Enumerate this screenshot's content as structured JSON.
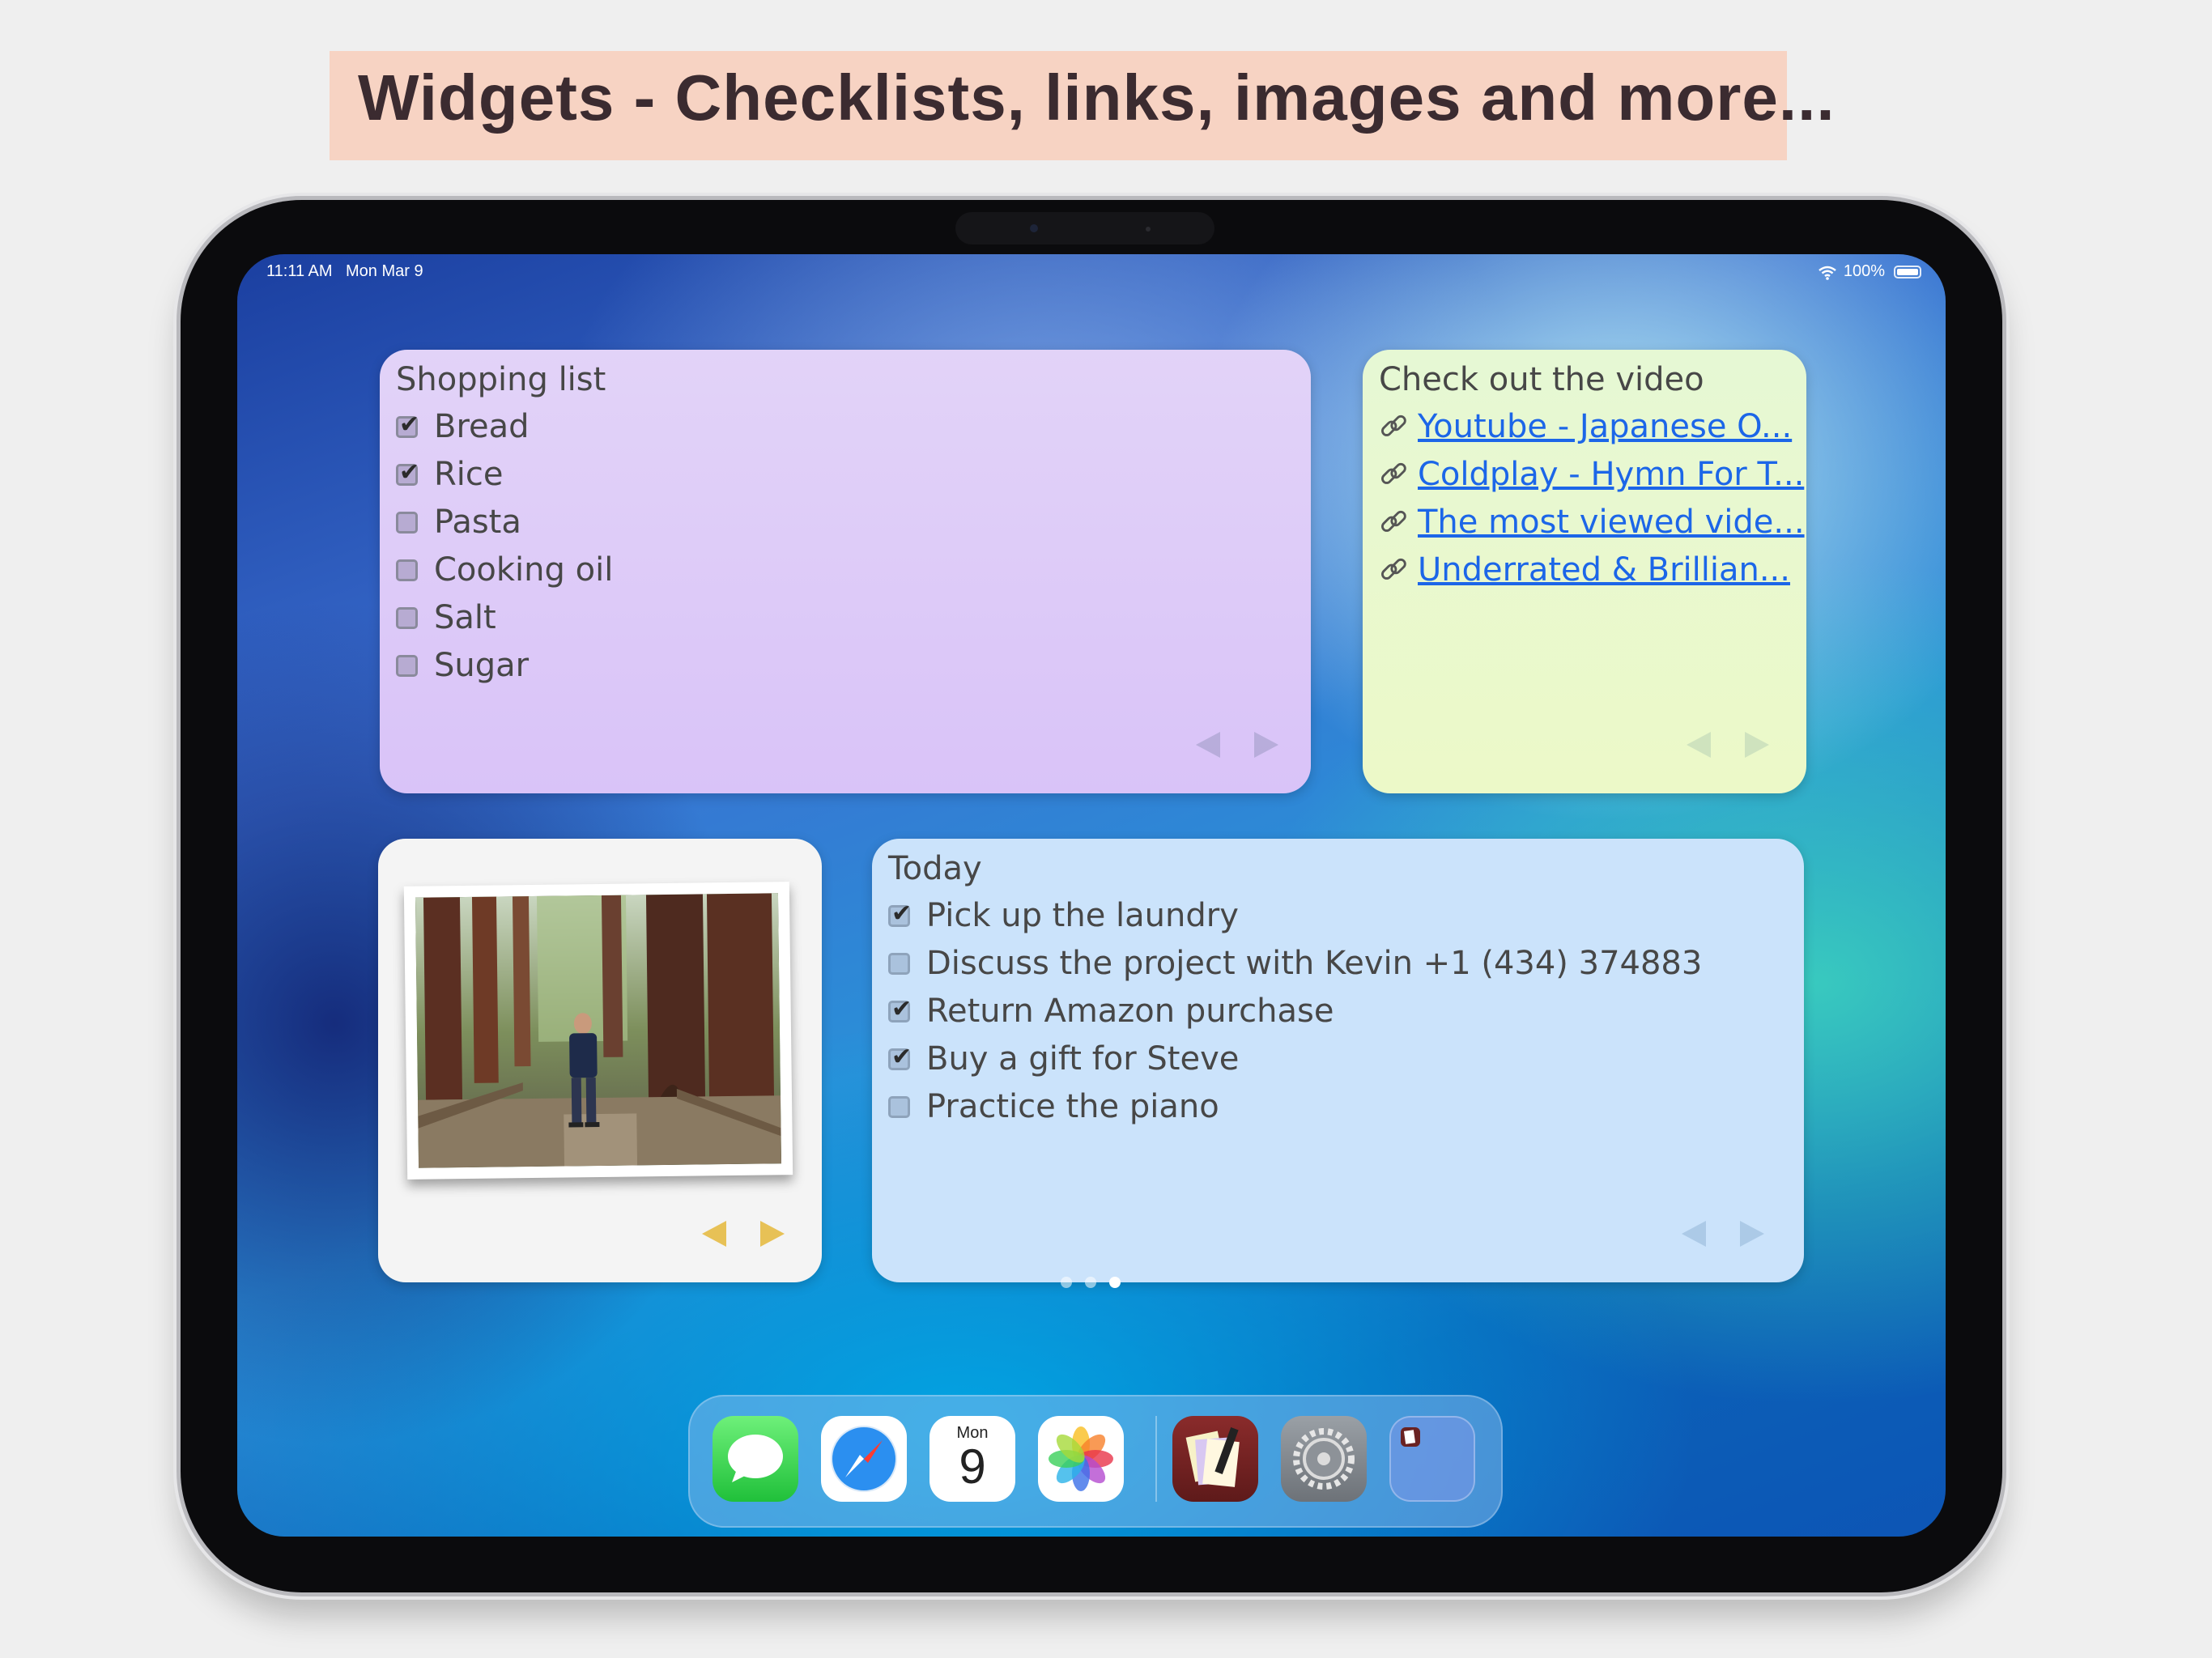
{
  "banner": {
    "title": "Widgets - Checklists, links, images and more..."
  },
  "status_bar": {
    "time": "11:11 AM",
    "date": "Mon Mar 9",
    "battery": "100%"
  },
  "widgets": {
    "shopping": {
      "title": "Shopping list",
      "items": [
        {
          "label": "Bread",
          "checked": true
        },
        {
          "label": "Rice",
          "checked": true
        },
        {
          "label": "Pasta",
          "checked": false
        },
        {
          "label": "Cooking oil",
          "checked": false
        },
        {
          "label": "Salt",
          "checked": false
        },
        {
          "label": "Sugar",
          "checked": false
        }
      ]
    },
    "video": {
      "title": "Check out the video",
      "links": [
        "Youtube - Japanese O...",
        "Coldplay - Hymn For T...",
        "The most viewed vide...",
        "Underrated & Brillian..."
      ]
    },
    "today": {
      "title": "Today",
      "items": [
        {
          "label": "Pick up the laundry",
          "checked": true
        },
        {
          "label": "Discuss the project with Kevin +1 (434) 374883",
          "checked": false
        },
        {
          "label": "Return Amazon purchase",
          "checked": true
        },
        {
          "label": "Buy a gift for Steve",
          "checked": true
        },
        {
          "label": "Practice the piano",
          "checked": false
        }
      ]
    }
  },
  "page_indicator": {
    "count": 3,
    "active": 3
  },
  "dock": {
    "apps": [
      "messages-app",
      "safari-app",
      "calendar-app",
      "photos-app",
      "notes-widget-app",
      "settings-app",
      "app-library-folder"
    ],
    "calendar_day": "Mon",
    "calendar_date": "9"
  }
}
